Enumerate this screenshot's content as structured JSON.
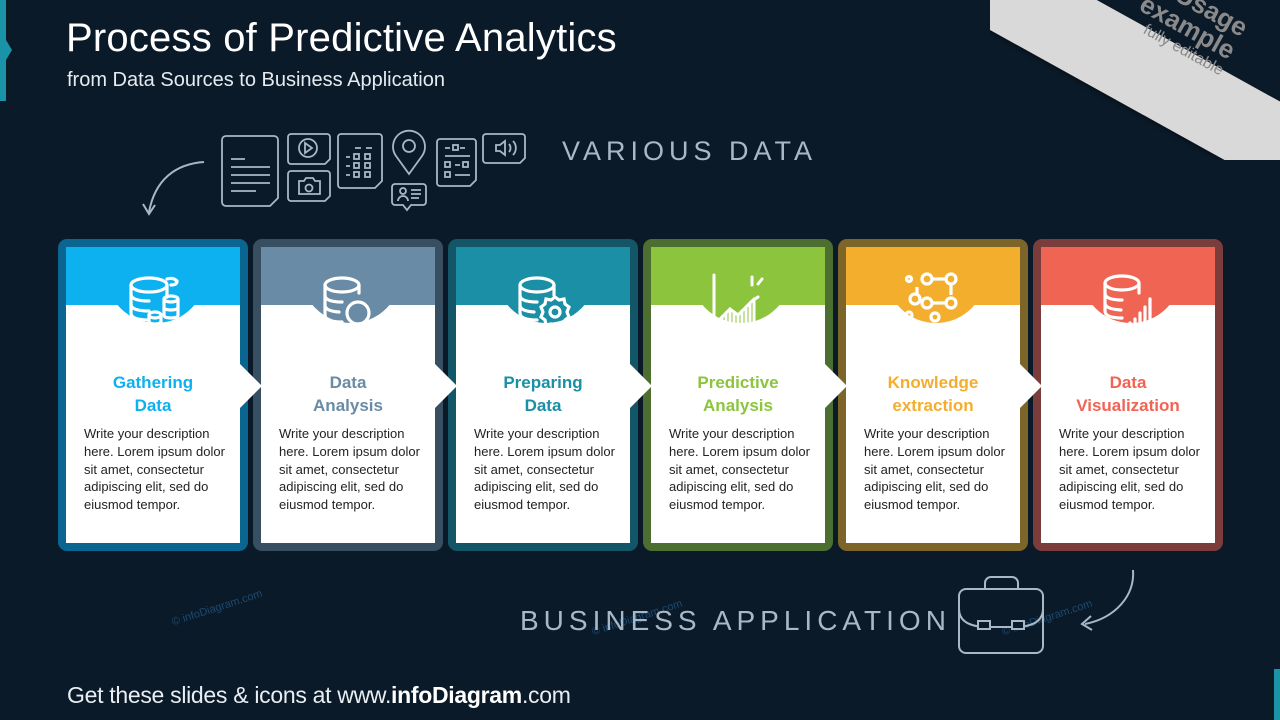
{
  "header": {
    "title": "Process of Predictive Analytics",
    "subtitle": "from Data Sources to Business  Application"
  },
  "ribbon": {
    "line1": "Usage",
    "line2": "example",
    "line3": "fully editable",
    "background": "#d9d9d9",
    "text_color": "#8a8a8a"
  },
  "labels": {
    "various_data": "VARIOUS DATA",
    "business_application": "BUSINESS APPLICATION"
  },
  "data_icons": [
    "document-icon",
    "play-video-icon",
    "camera-icon",
    "spreadsheet-icon",
    "location-pin-icon",
    "contact-card-icon",
    "form-icon",
    "audio-icon"
  ],
  "steps": [
    {
      "title_line1": "Gathering",
      "title_line2": "Data",
      "description": "Write your description here. Lorem ipsum dolor sit amet, consectetur adipiscing elit, sed do eiusmod tempor.",
      "icon": "database-coins-icon",
      "color": "#0db1f0",
      "border_color": "#0b6591"
    },
    {
      "title_line1": "Data",
      "title_line2": "Analysis",
      "description": "Write your description here. Lorem ipsum dolor sit amet, consectetur adipiscing elit, sed do eiusmod tempor.",
      "icon": "database-search-icon",
      "color": "#6a8ba5",
      "border_color": "#384f62"
    },
    {
      "title_line1": "Preparing",
      "title_line2": "Data",
      "description": "Write your description here. Lorem ipsum dolor sit amet, consectetur adipiscing elit, sed do eiusmod tempor.",
      "icon": "database-badge-icon",
      "color": "#1a8fa6",
      "border_color": "#125668"
    },
    {
      "title_line1": "Predictive",
      "title_line2": "Analysis",
      "description": "Write your description here. Lorem ipsum dolor sit amet, consectetur adipiscing elit, sed do eiusmod tempor.",
      "icon": "growth-chart-icon",
      "color": "#8cc43e",
      "border_color": "#4d6e31"
    },
    {
      "title_line1": "Knowledge",
      "title_line2": "extraction",
      "description": "Write your description here. Lorem ipsum dolor sit amet, consectetur adipiscing elit, sed do eiusmod tempor.",
      "icon": "network-nodes-icon",
      "color": "#f3ae2e",
      "border_color": "#7d6428"
    },
    {
      "title_line1": "Data",
      "title_line2": "Visualization",
      "description": "Write your description here. Lorem ipsum dolor sit amet, consectetur adipiscing elit, sed do eiusmod tempor.",
      "icon": "database-chart-icon",
      "color": "#f06454",
      "border_color": "#7b3c3c"
    }
  ],
  "watermark": "© infoDiagram.com",
  "footer": {
    "prefix": "Get these slides & icons at www.",
    "brand": "infoDiagram",
    "suffix": ".com"
  },
  "colors": {
    "background": "#0b1a28",
    "accent": "#1a93a8",
    "label_gray": "#a8b8c6"
  }
}
